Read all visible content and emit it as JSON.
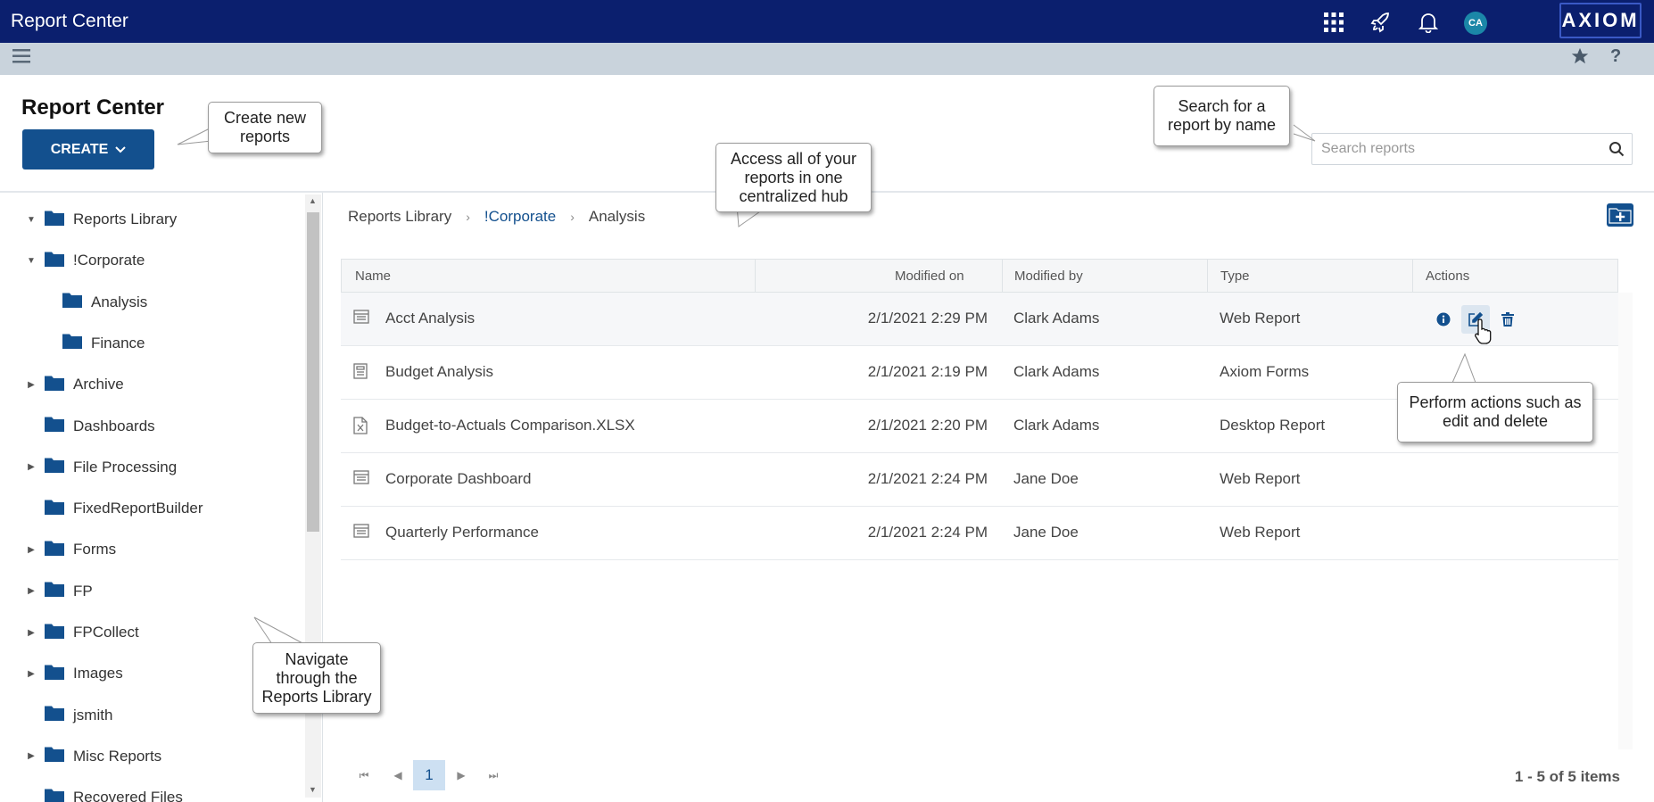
{
  "app": {
    "title": "Report Center",
    "logo": "AXIOM",
    "avatar_initials": "CA"
  },
  "header": {
    "page_title": "Report Center",
    "create_label": "CREATE",
    "search_placeholder": "Search reports"
  },
  "sidebar": {
    "items": [
      {
        "label": "Reports Library",
        "expanded": true
      },
      {
        "label": "!Corporate",
        "expanded": true
      },
      {
        "label": "Analysis"
      },
      {
        "label": "Finance"
      },
      {
        "label": "Archive",
        "expandable": true
      },
      {
        "label": "Dashboards"
      },
      {
        "label": "File Processing",
        "expandable": true
      },
      {
        "label": "FixedReportBuilder"
      },
      {
        "label": "Forms",
        "expandable": true
      },
      {
        "label": "FP",
        "expandable": true
      },
      {
        "label": "FPCollect",
        "expandable": true
      },
      {
        "label": "Images",
        "expandable": true
      },
      {
        "label": "jsmith"
      },
      {
        "label": "Misc Reports",
        "expandable": true
      },
      {
        "label": "Recovered Files"
      }
    ]
  },
  "breadcrumb": {
    "items": [
      "Reports Library",
      "!Corporate",
      "Analysis"
    ]
  },
  "grid": {
    "columns": [
      "Name",
      "Modified on",
      "Modified by",
      "Type",
      "Actions"
    ],
    "rows": [
      {
        "name": "Acct Analysis",
        "modified_on": "2/1/2021 2:29 PM",
        "modified_by": "Clark Adams",
        "type": "Web Report",
        "icon": "web-report-icon"
      },
      {
        "name": "Budget Analysis",
        "modified_on": "2/1/2021 2:19 PM",
        "modified_by": "Clark Adams",
        "type": "Axiom Forms",
        "icon": "form-icon"
      },
      {
        "name": "Budget-to-Actuals Comparison.XLSX",
        "modified_on": "2/1/2021 2:20 PM",
        "modified_by": "Clark Adams",
        "type": "Desktop Report",
        "icon": "excel-file-icon"
      },
      {
        "name": "Corporate Dashboard",
        "modified_on": "2/1/2021 2:24 PM",
        "modified_by": "Jane Doe",
        "type": "Web Report",
        "icon": "web-report-icon"
      },
      {
        "name": "Quarterly Performance",
        "modified_on": "2/1/2021 2:24 PM",
        "modified_by": "Jane Doe",
        "type": "Web Report",
        "icon": "web-report-icon"
      }
    ]
  },
  "pager": {
    "current_page": "1",
    "info": "1 - 5 of 5 items"
  },
  "callouts": {
    "create": "Create new reports",
    "search": "Search for a report by name",
    "hub": "Access all of your reports in one centralized hub",
    "actions": "Perform actions such as edit and delete",
    "navigate": "Navigate through the Reports Library"
  },
  "colors": {
    "topbar": "#0b1f6e",
    "subbar": "#c9d3dc",
    "primary": "#13508e",
    "folder": "#13508e"
  }
}
